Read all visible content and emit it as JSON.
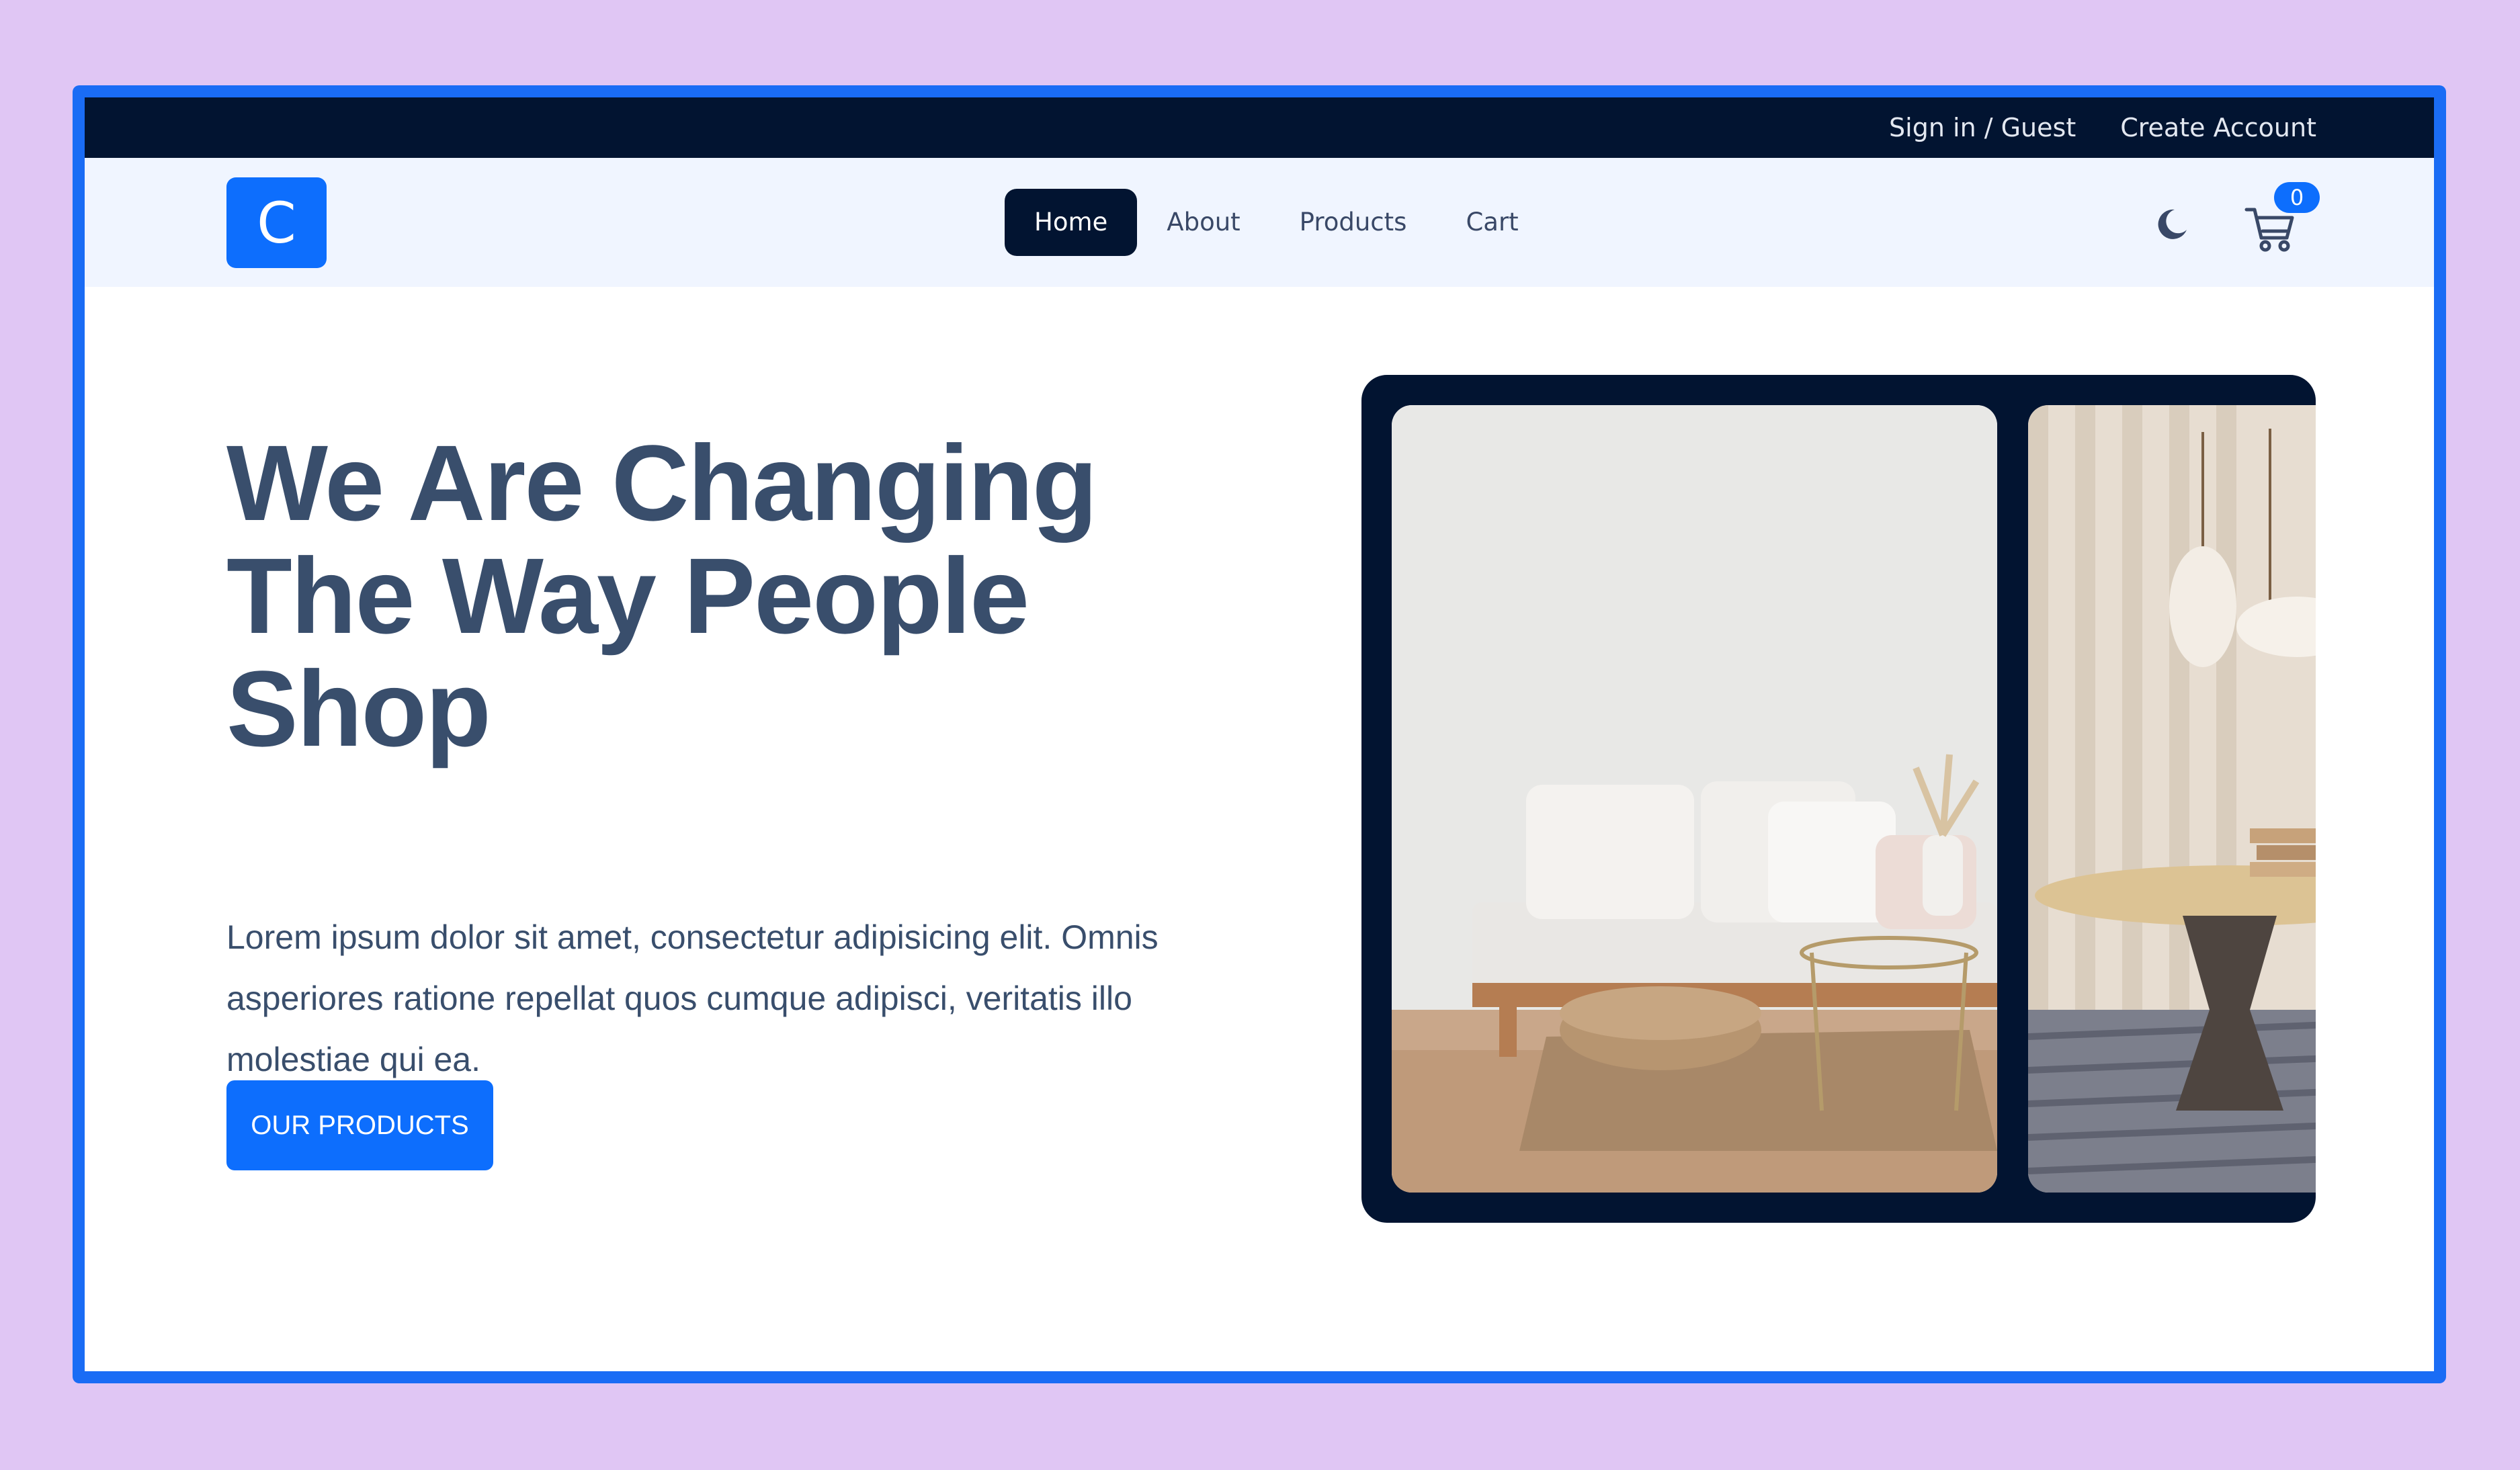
{
  "topbar": {
    "sign_in": "Sign in / Guest",
    "create_account": "Create Account"
  },
  "navbar": {
    "logo_letter": "C",
    "links": [
      {
        "label": "Home",
        "active": true
      },
      {
        "label": "About",
        "active": false
      },
      {
        "label": "Products",
        "active": false
      },
      {
        "label": "Cart",
        "active": false
      }
    ],
    "theme_icon": "moon-icon",
    "cart_icon": "cart-icon",
    "cart_count": "0"
  },
  "hero": {
    "title_lines": [
      "We Are Changing",
      "The Way People",
      "Shop"
    ],
    "description": "Lorem ipsum dolor sit amet, consectetur adipisicing elit. Omnis asperiores ratione repellat quos cumque adipisci, veritatis illo molestiae qui ea.",
    "cta_label": "OUR PRODUCTS"
  },
  "colors": {
    "accent": "#0d6efd",
    "dark": "#021431",
    "text": "#394e6c",
    "nav_bg": "#f0f5ff"
  }
}
